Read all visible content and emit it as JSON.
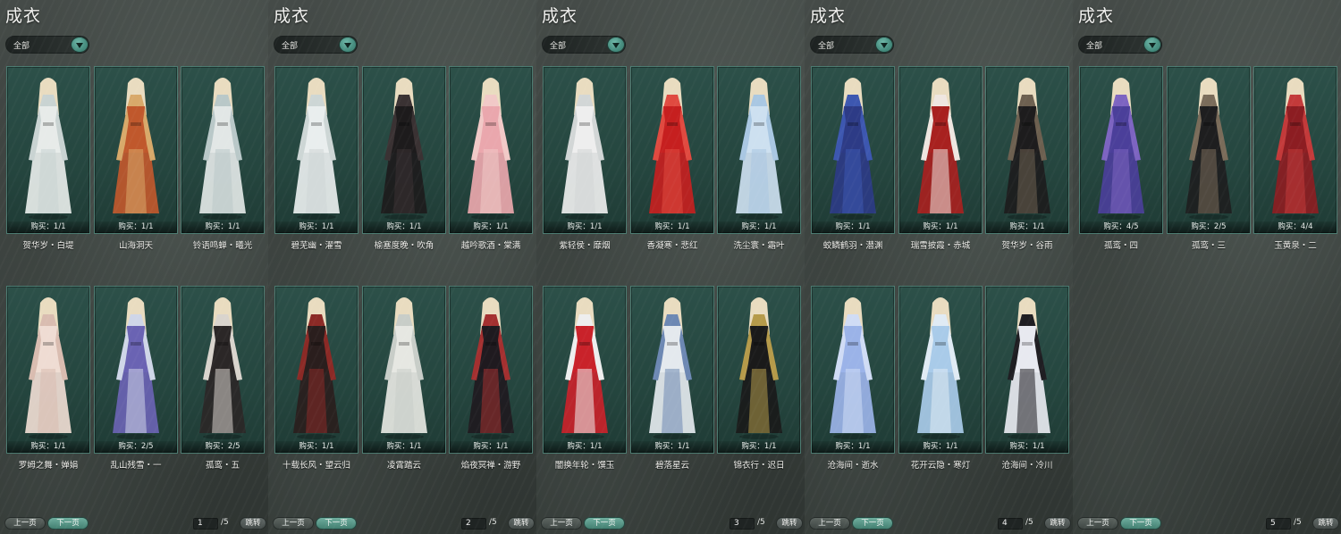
{
  "pages": [
    {
      "title": "成衣",
      "filter": "全部",
      "items": [
        {
          "name": "贺华岁・白堤",
          "count": "购买：1/1",
          "palette": [
            "#e7ebe9",
            "#c9d3d2"
          ]
        },
        {
          "name": "山海洞天",
          "count": "购买：1/1",
          "palette": [
            "#c0582c",
            "#d8a96a"
          ]
        },
        {
          "name": "铃语鸣蝉・曦光",
          "count": "购买：1/1",
          "palette": [
            "#e2e7e6",
            "#b9c8c8"
          ]
        },
        {
          "name": "罗姆之舞・婵娟",
          "count": "购买：1/1",
          "palette": [
            "#efdcd3",
            "#d9bcb0"
          ]
        },
        {
          "name": "乱山残雪・一",
          "count": "购买：2/5",
          "palette": [
            "#6a63b3",
            "#cfd6e8"
          ]
        },
        {
          "name": "孤鸾・五",
          "count": "购买：2/5",
          "palette": [
            "#2b2727",
            "#d9d4cd"
          ]
        }
      ],
      "prev": "上一页",
      "next": "下一页",
      "page": "1",
      "total": "/5",
      "jump": "跳转"
    },
    {
      "title": "成衣",
      "filter": "全部",
      "items": [
        {
          "name": "碧芜幽・濯雪",
          "count": "购买：1/1",
          "palette": [
            "#e9eeee",
            "#cdd6d5"
          ]
        },
        {
          "name": "榆塞度晚・吹角",
          "count": "购买：1/1",
          "palette": [
            "#1d1b1c",
            "#3a3233"
          ]
        },
        {
          "name": "越吟歌酒・棠满",
          "count": "购买：1/1",
          "palette": [
            "#eaa7ad",
            "#f1c9c7"
          ]
        },
        {
          "name": "十载长风・望云归",
          "count": "购买：1/1",
          "palette": [
            "#2a1e1d",
            "#8b2a26"
          ]
        },
        {
          "name": "凌霄踏云",
          "count": "购买：1/1",
          "palette": [
            "#e6e7e2",
            "#c8cdc8"
          ]
        },
        {
          "name": "焰夜冥禅・游野",
          "count": "购买：1/1",
          "palette": [
            "#1f1a1f",
            "#a43030"
          ]
        }
      ],
      "prev": "上一页",
      "next": "下一页",
      "page": "2",
      "total": "/5",
      "jump": "跳转"
    },
    {
      "title": "成衣",
      "filter": "全部",
      "items": [
        {
          "name": "紫轻侯・靡烟",
          "count": "购买：1/1",
          "palette": [
            "#eeeeee",
            "#d2d6d6"
          ]
        },
        {
          "name": "香凝寒・悲红",
          "count": "购买：1/1",
          "palette": [
            "#c61f1f",
            "#e04a40"
          ]
        },
        {
          "name": "洗尘寰・霜叶",
          "count": "购买：1/1",
          "palette": [
            "#cde0f0",
            "#a9c7e2"
          ]
        },
        {
          "name": "闇换年轮・馔玉",
          "count": "购买：1/1",
          "palette": [
            "#c9222a",
            "#eeeeee"
          ]
        },
        {
          "name": "碧落星云",
          "count": "购买：1/1",
          "palette": [
            "#e4e9ee",
            "#6d88b3"
          ]
        },
        {
          "name": "锦衣行・迟日",
          "count": "购买：1/1",
          "palette": [
            "#1a1a1a",
            "#b59a4a"
          ]
        }
      ],
      "prev": "上一页",
      "next": "下一页",
      "page": "3",
      "total": "/5",
      "jump": "跳转"
    },
    {
      "title": "成衣",
      "filter": "全部",
      "items": [
        {
          "name": "蛟鳞鹤羽・潜渊",
          "count": "购买：1/1",
          "palette": [
            "#2d3b86",
            "#3d57b0"
          ]
        },
        {
          "name": "瑞雪披霞・赤城",
          "count": "购买：1/1",
          "palette": [
            "#a8211f",
            "#efe6e0"
          ]
        },
        {
          "name": "贺华岁・谷雨",
          "count": "购买：1/1",
          "palette": [
            "#1d1c1d",
            "#6d6050"
          ]
        },
        {
          "name": "沧海间・逝水",
          "count": "购买：1/1",
          "palette": [
            "#9bb3e8",
            "#d0dcf5"
          ]
        },
        {
          "name": "花开云隐・寒灯",
          "count": "购买：1/1",
          "palette": [
            "#a9cbe9",
            "#e0ebf4"
          ]
        },
        {
          "name": "沧海间・冷川",
          "count": "购买：1/1",
          "palette": [
            "#e8e9f0",
            "#1f1e22"
          ]
        }
      ],
      "prev": "上一页",
      "next": "下一页",
      "page": "4",
      "total": "/5",
      "jump": "跳转"
    },
    {
      "title": "成衣",
      "filter": "全部",
      "items": [
        {
          "name": "孤鸾・四",
          "count": "购买：4/5",
          "palette": [
            "#4b3f9a",
            "#7d64c1"
          ]
        },
        {
          "name": "孤鸾・三",
          "count": "购买：2/5",
          "palette": [
            "#1e1e1f",
            "#7a6c5a"
          ]
        },
        {
          "name": "玉黄泉・二",
          "count": "购买：4/4",
          "palette": [
            "#8c1d22",
            "#c33a3a"
          ]
        }
      ],
      "prev": "上一页",
      "next": "下一页",
      "page": "5",
      "total": "/5",
      "jump": "跳转"
    }
  ]
}
